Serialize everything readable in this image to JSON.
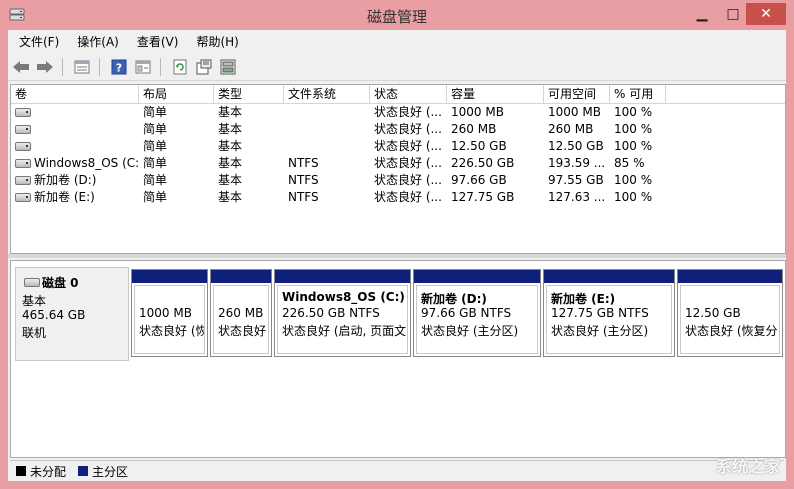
{
  "window": {
    "title": "磁盘管理"
  },
  "menu": [
    "文件(F)",
    "操作(A)",
    "查看(V)",
    "帮助(H)"
  ],
  "toolbar_icons": [
    "back-arrow-icon",
    "forward-arrow-icon",
    "disk-list-icon",
    "help-icon",
    "properties-icon",
    "refresh-icon",
    "settings-icon",
    "rescan-icon"
  ],
  "volumes": {
    "columns": [
      "卷",
      "布局",
      "类型",
      "文件系统",
      "状态",
      "容量",
      "可用空间",
      "% 可用"
    ],
    "rows": [
      [
        "",
        "简单",
        "基本",
        "",
        "状态良好 (...",
        "1000 MB",
        "1000 MB",
        "100 %"
      ],
      [
        "",
        "简单",
        "基本",
        "",
        "状态良好 (...",
        "260 MB",
        "260 MB",
        "100 %"
      ],
      [
        "",
        "简单",
        "基本",
        "",
        "状态良好 (...",
        "12.50 GB",
        "12.50 GB",
        "100 %"
      ],
      [
        "Windows8_OS (C:)",
        "简单",
        "基本",
        "NTFS",
        "状态良好 (...",
        "226.50 GB",
        "193.59 ...",
        "85 %"
      ],
      [
        "新加卷 (D:)",
        "简单",
        "基本",
        "NTFS",
        "状态良好 (...",
        "97.66 GB",
        "97.55 GB",
        "100 %"
      ],
      [
        "新加卷 (E:)",
        "简单",
        "基本",
        "NTFS",
        "状态良好 (...",
        "127.75 GB",
        "127.63 ...",
        "100 %"
      ]
    ]
  },
  "disk": {
    "name": "磁盘 0",
    "type": "基本",
    "size": "465.64 GB",
    "status": "联机",
    "partitions": [
      {
        "name": "",
        "size": "1000 MB",
        "status": "状态良好 (恢"
      },
      {
        "name": "",
        "size": "260 MB",
        "status": "状态良好"
      },
      {
        "name": "Windows8_OS  (C:)",
        "size": "226.50 GB NTFS",
        "status": "状态良好 (启动, 页面文"
      },
      {
        "name": "新加卷  (D:)",
        "size": "97.66 GB NTFS",
        "status": "状态良好 (主分区)"
      },
      {
        "name": "新加卷  (E:)",
        "size": "127.75 GB NTFS",
        "status": "状态良好 (主分区)"
      },
      {
        "name": "",
        "size": "12.50 GB",
        "status": "状态良好 (恢复分"
      }
    ]
  },
  "legend": [
    {
      "label": "未分配",
      "color": "#000000"
    },
    {
      "label": "主分区",
      "color": "#0f1f7a"
    }
  ],
  "watermark": "系统之家"
}
